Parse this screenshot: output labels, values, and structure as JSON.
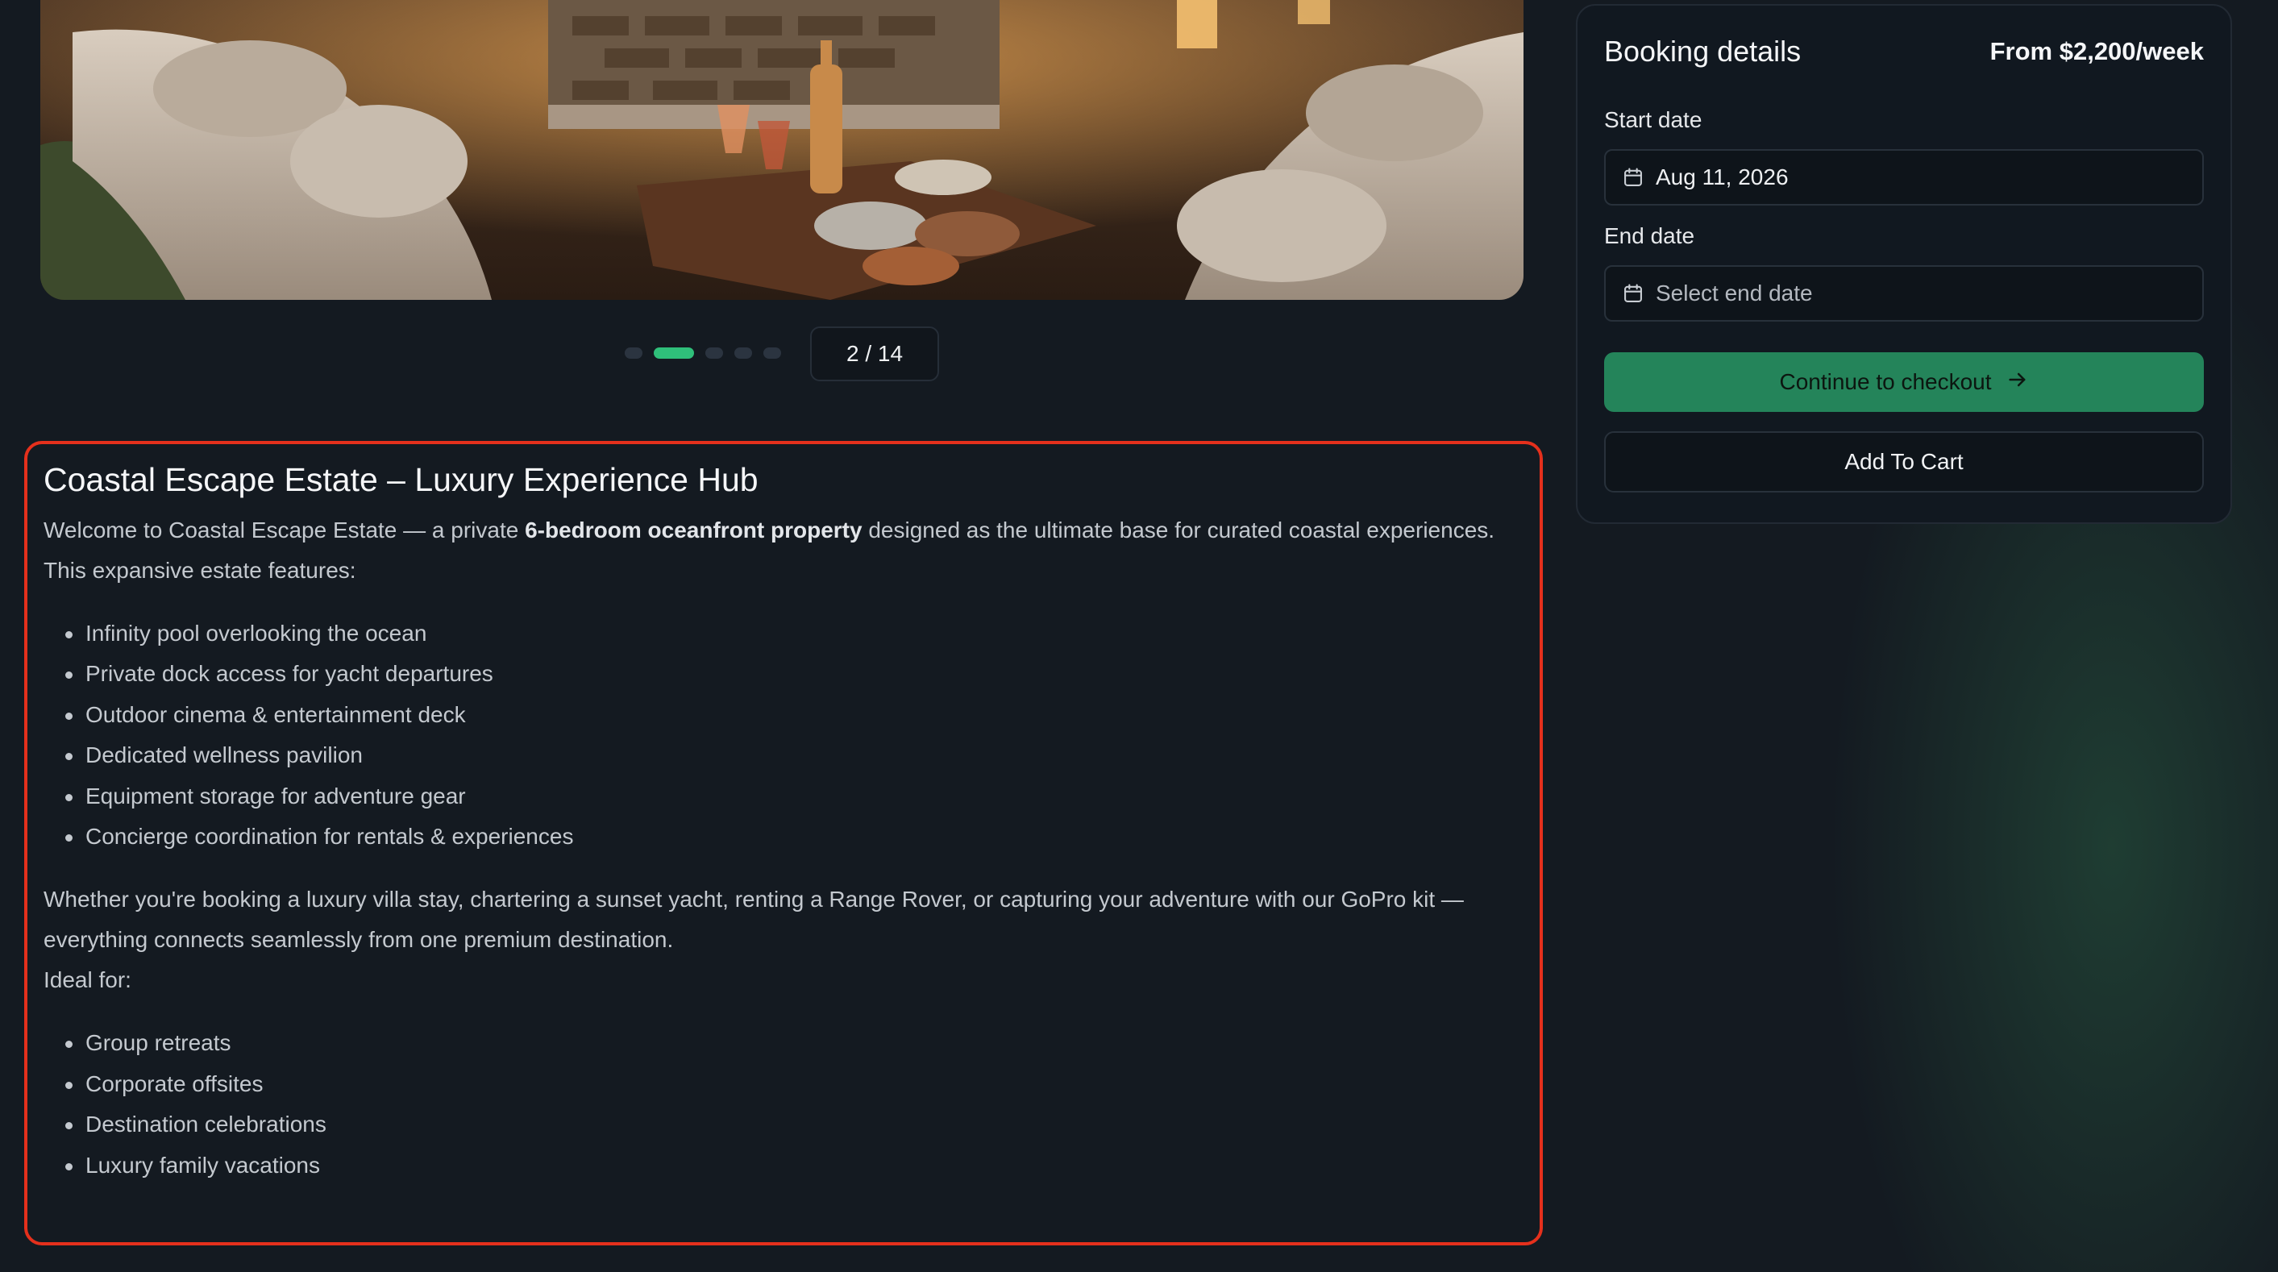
{
  "carousel": {
    "counter": "2 / 14",
    "dots": 5,
    "active_dot": 2
  },
  "description": {
    "title": "Coastal Escape Estate – Luxury Experience Hub",
    "intro_before": "Welcome to Coastal Escape Estate — a private ",
    "intro_bold": "6-bedroom oceanfront property",
    "intro_after": " designed as the ultimate base for curated coastal experiences.",
    "features_lead": "This expansive estate features:",
    "features": [
      "Infinity pool overlooking the ocean",
      "Private dock access for yacht departures",
      "Outdoor cinema & entertainment deck",
      "Dedicated wellness pavilion",
      "Equipment storage for adventure gear",
      "Concierge coordination for rentals & experiences"
    ],
    "body": "Whether you're booking a luxury villa stay, chartering a sunset yacht, renting a Range Rover, or capturing your adventure with our GoPro kit — everything connects seamlessly from one premium destination.",
    "ideal_lead": "Ideal for:",
    "ideal": [
      "Group retreats",
      "Corporate offsites",
      "Destination celebrations",
      "Luxury family vacations"
    ]
  },
  "booking": {
    "title": "Booking details",
    "price": "From $2,200/week",
    "start_label": "Start date",
    "start_value": "Aug 11, 2026",
    "end_label": "End date",
    "end_placeholder": "Select end date",
    "checkout_label": "Continue to checkout",
    "cart_label": "Add To Cart"
  },
  "colors": {
    "accent": "#2fbf7a",
    "checkout_button": "#24845a",
    "highlight_border": "#e5301c",
    "background": "#141a21"
  },
  "icons": {
    "date_field": "calendar-icon",
    "checkout": "arrow-right-icon"
  }
}
